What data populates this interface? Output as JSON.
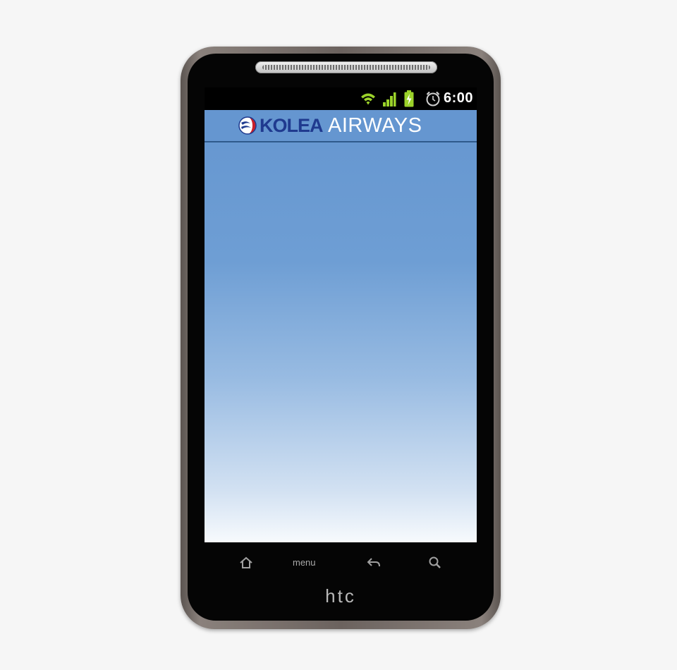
{
  "status_bar": {
    "time": "6:00",
    "icons": [
      "wifi-icon",
      "signal-icon",
      "battery-charging-icon",
      "alarm-clock-icon"
    ],
    "icon_color": "#9bd22a"
  },
  "app": {
    "logo_part1": "KOLEA",
    "logo_part2": "AIRWAYS",
    "logo_colors": {
      "kolea": "#1f3a8f",
      "airways": "#ffffff",
      "header": "#6596d0"
    }
  },
  "device": {
    "brand": "htc",
    "nav_keys": {
      "home": "home-icon",
      "menu": "menu",
      "back": "back-icon",
      "search": "search-icon"
    }
  }
}
